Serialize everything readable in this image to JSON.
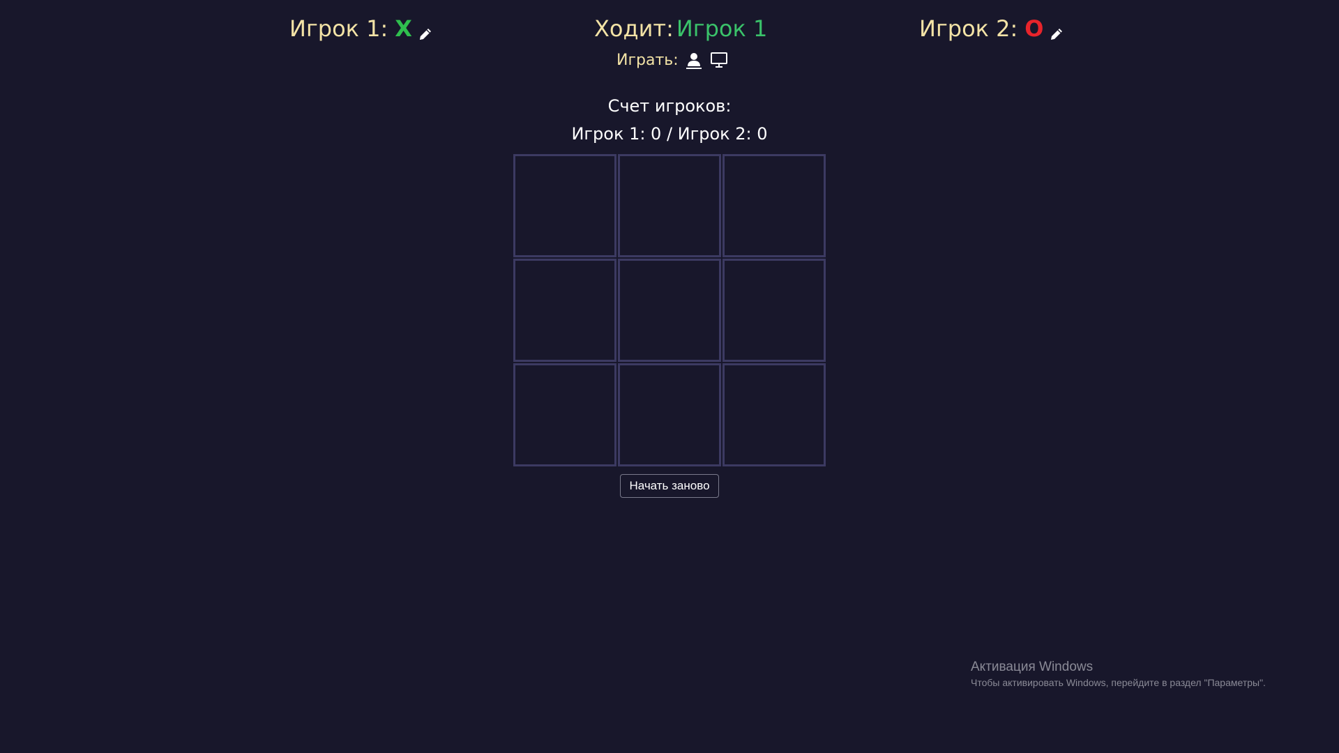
{
  "header": {
    "player1": {
      "label": "Игрок 1:",
      "symbol": "X",
      "symbol_color": "#2fbf4e",
      "edit_icon": "pencil-icon"
    },
    "player2": {
      "label": "Игрок 2:",
      "symbol": "O",
      "symbol_color": "#e8242b",
      "edit_icon": "pencil-icon"
    },
    "turn": {
      "label": "Ходит:",
      "current_player": "Игрок 1",
      "current_color": "#3ac26a"
    },
    "play_mode": {
      "label": "Играть:",
      "options": [
        "person-icon",
        "monitor-icon"
      ]
    }
  },
  "score": {
    "title": "Счет игроков:",
    "line": "Игрок 1: 0 / Игрок 2: 0"
  },
  "board": {
    "cells": [
      "",
      "",
      "",
      "",
      "",
      "",
      "",
      "",
      ""
    ],
    "line_color": "#3c3a62"
  },
  "restart_button": {
    "label": "Начать заново"
  },
  "windows_activation": {
    "title": "Активация Windows",
    "subtitle": "Чтобы активировать Windows, перейдите в раздел \"Параметры\"."
  },
  "colors": {
    "background": "#18172b",
    "label_text": "#f3e3a6"
  }
}
